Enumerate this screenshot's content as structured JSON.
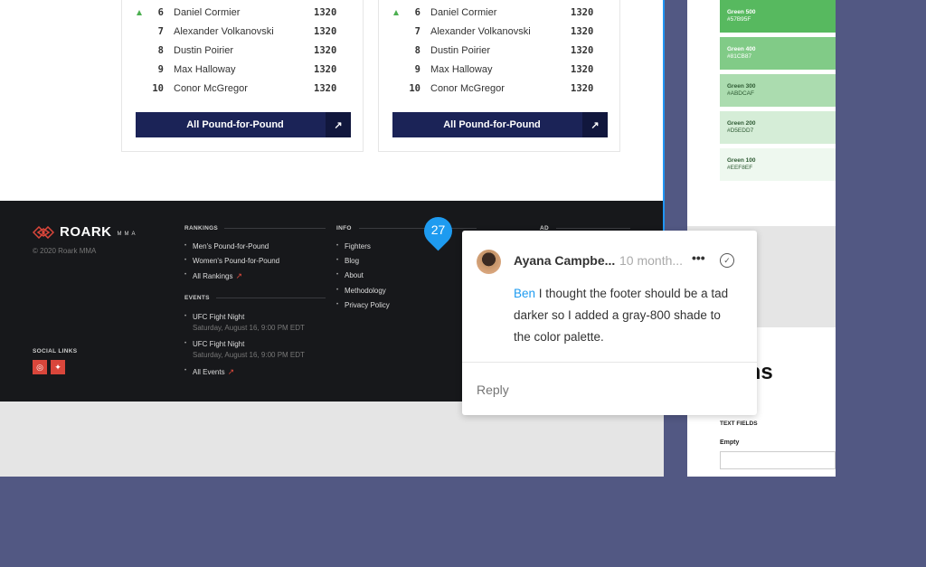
{
  "rankings_cards": [
    {
      "rows": [
        {
          "rank": "6",
          "name": "Daniel Cormier",
          "score": "1320",
          "trend": "up"
        },
        {
          "rank": "7",
          "name": "Alexander Volkanovski",
          "score": "1320"
        },
        {
          "rank": "8",
          "name": "Dustin Poirier",
          "score": "1320"
        },
        {
          "rank": "9",
          "name": "Max Halloway",
          "score": "1320"
        },
        {
          "rank": "10",
          "name": "Conor McGregor",
          "score": "1320"
        }
      ],
      "button": "All Pound-for-Pound"
    },
    {
      "rows": [
        {
          "rank": "6",
          "name": "Daniel Cormier",
          "score": "1320",
          "trend": "up"
        },
        {
          "rank": "7",
          "name": "Alexander Volkanovski",
          "score": "1320"
        },
        {
          "rank": "8",
          "name": "Dustin Poirier",
          "score": "1320"
        },
        {
          "rank": "9",
          "name": "Max Halloway",
          "score": "1320"
        },
        {
          "rank": "10",
          "name": "Conor McGregor",
          "score": "1320"
        }
      ],
      "button": "All Pound-for-Pound"
    }
  ],
  "footer": {
    "logo_word": "ROARK",
    "logo_sub": "MMA",
    "copyright": "© 2020 Roark MMA",
    "rankings_title": "RANKINGS",
    "rankings": [
      "Men's Pound-for-Pound",
      "Women's Pound-for-Pound",
      "All Rankings"
    ],
    "events_title": "EVENTS",
    "events": [
      {
        "name": "UFC Fight Night",
        "date": "Saturday, August 16, 9:00 PM EDT"
      },
      {
        "name": "UFC Fight Night",
        "date": "Saturday, August 16, 9:00 PM EDT"
      }
    ],
    "all_events": "All Events",
    "info_title": "INFO",
    "info": [
      "Fighters",
      "Blog",
      "About",
      "Methodology",
      "Privacy Policy"
    ],
    "ad_title": "AD",
    "social_title": "SOCIAL LINKS",
    "social": [
      "instagram-icon",
      "twitter-icon"
    ]
  },
  "palette": [
    {
      "name": "Green 500",
      "hex": "#57B95F",
      "color": "#57b95f",
      "text": "#ffffff"
    },
    {
      "name": "Green 400",
      "hex": "#81CB87",
      "color": "#81cb87",
      "text": "#ffffff"
    },
    {
      "name": "Green 300",
      "hex": "#ABDCAF",
      "color": "#abdcaf",
      "text": "#2e5a33"
    },
    {
      "name": "Green 200",
      "hex": "#D5EDD7",
      "color": "#d5edd7",
      "text": "#2e5a33"
    },
    {
      "name": "Green 100",
      "hex": "#EEF8EF",
      "color": "#eef8ef",
      "text": "#2e5a33"
    }
  ],
  "forms": {
    "heading_fragment": "ms",
    "section": "TEXT FIELDS",
    "field_label": "Empty"
  },
  "comment_pin": "27",
  "comment": {
    "author": "Ayana Campbe...",
    "time": "10 month...",
    "more": "•••",
    "mention": "Ben",
    "body": " I thought the footer should be a tad darker so I added a gray-800 shade to the color palette.",
    "reply_placeholder": "Reply"
  }
}
